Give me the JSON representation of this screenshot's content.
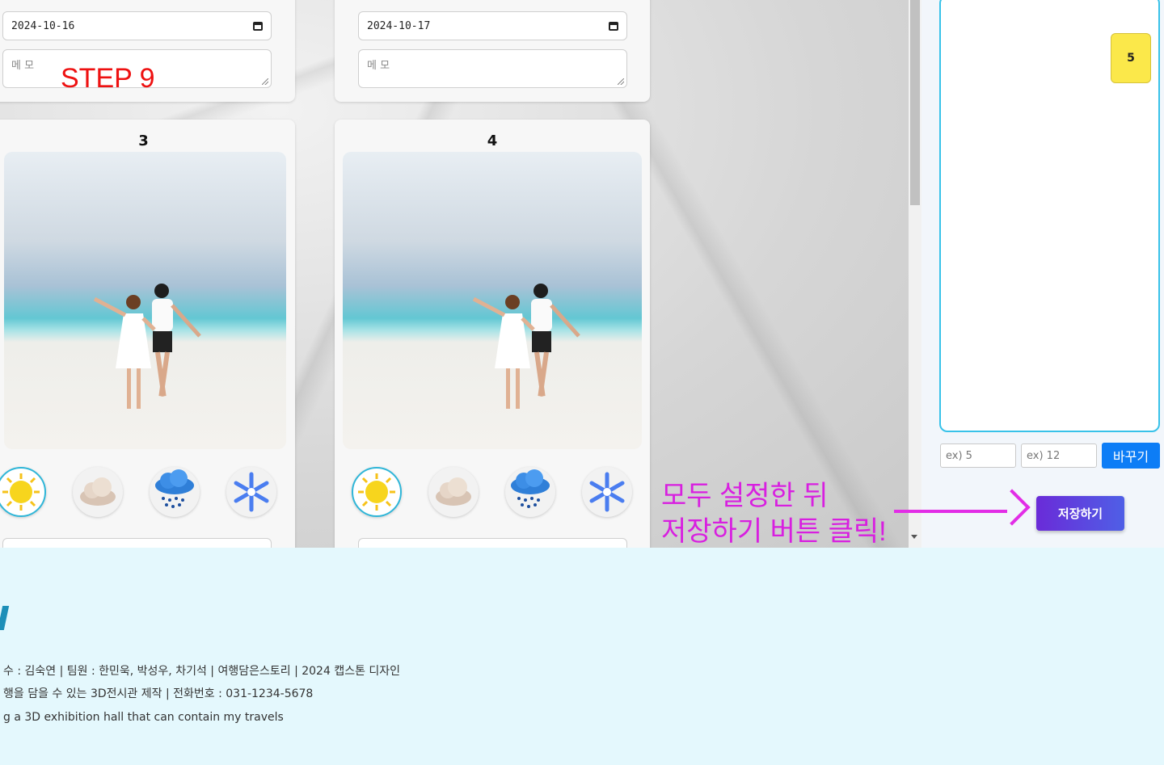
{
  "step_label": "STEP 9",
  "cards": [
    {
      "number": "",
      "date": "2024-10-16",
      "memo_placeholder": "메 모"
    },
    {
      "number": "",
      "date": "2024-10-17",
      "memo_placeholder": "메 모"
    },
    {
      "number": "3",
      "date": "",
      "memo_placeholder": ""
    },
    {
      "number": "4",
      "date": "",
      "memo_placeholder": ""
    }
  ],
  "weather_icons": [
    "sun-icon",
    "cloud-icon",
    "rain-icon",
    "snow-icon"
  ],
  "instruction": {
    "line1": "모두 설정한 뒤",
    "line2": "저장하기 버튼 클릭!"
  },
  "panel": {
    "sticky_value": "5",
    "input1_placeholder": "ex) 5",
    "input2_placeholder": "ex) 12",
    "change_button": "바꾸기",
    "save_button": "저장하기"
  },
  "footer": {
    "line1": "수 : 김숙연  |  팀원 : 한민욱, 박성우, 차기석  |  여행담은스토리  |  2024 캡스톤 디자인",
    "line2": "행을 담을 수 있는 3D전시관 제작  |  전화번호 : 031-1234-5678",
    "line3": "g a 3D exhibition hall that can contain my travels"
  },
  "colors": {
    "accent": "#0d7df6",
    "instruction": "#d81fe0",
    "step": "#ee1111",
    "footer_bg": "#e4f8fd"
  }
}
